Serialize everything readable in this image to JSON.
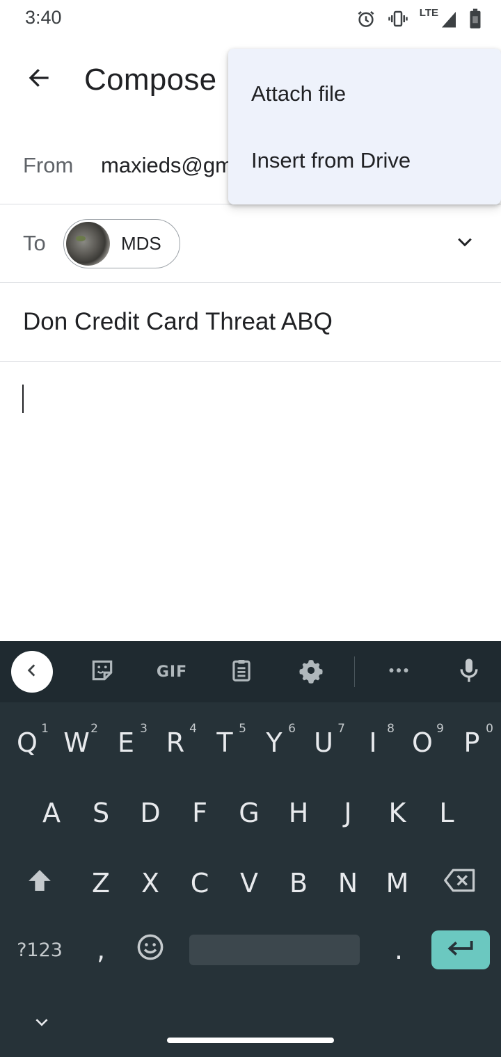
{
  "status_bar": {
    "time": "3:40",
    "network": "LTE",
    "icons": [
      "alarm-icon",
      "vibrate-icon",
      "signal-icon",
      "battery-icon"
    ]
  },
  "app_bar": {
    "title": "Compose",
    "back_icon": "arrow-back-icon"
  },
  "compose": {
    "from_label": "From",
    "from_value": "maxieds@gm",
    "to_label": "To",
    "recipient_chip": {
      "name": "MDS"
    },
    "subject": "Don Credit Card Threat ABQ",
    "body": ""
  },
  "overflow_menu": {
    "items": [
      {
        "label": "Attach file"
      },
      {
        "label": "Insert from Drive"
      }
    ]
  },
  "keyboard": {
    "toolbar": {
      "gif_label": "GIF",
      "icons": [
        "chevron-left-icon",
        "sticker-icon",
        "gif-icon",
        "clipboard-icon",
        "gear-icon",
        "more-horiz-icon",
        "mic-icon"
      ]
    },
    "row1": {
      "keys": [
        "Q",
        "W",
        "E",
        "R",
        "T",
        "Y",
        "U",
        "I",
        "O",
        "P"
      ],
      "hints": [
        "1",
        "2",
        "3",
        "4",
        "5",
        "6",
        "7",
        "8",
        "9",
        "0"
      ]
    },
    "row2": {
      "keys": [
        "A",
        "S",
        "D",
        "F",
        "G",
        "H",
        "J",
        "K",
        "L"
      ]
    },
    "row3": {
      "keys": [
        "Z",
        "X",
        "C",
        "V",
        "B",
        "N",
        "M"
      ]
    },
    "row4": {
      "symbols_label": "?123",
      "comma": ",",
      "period": "."
    },
    "accent_color": "#6bc8c0"
  }
}
